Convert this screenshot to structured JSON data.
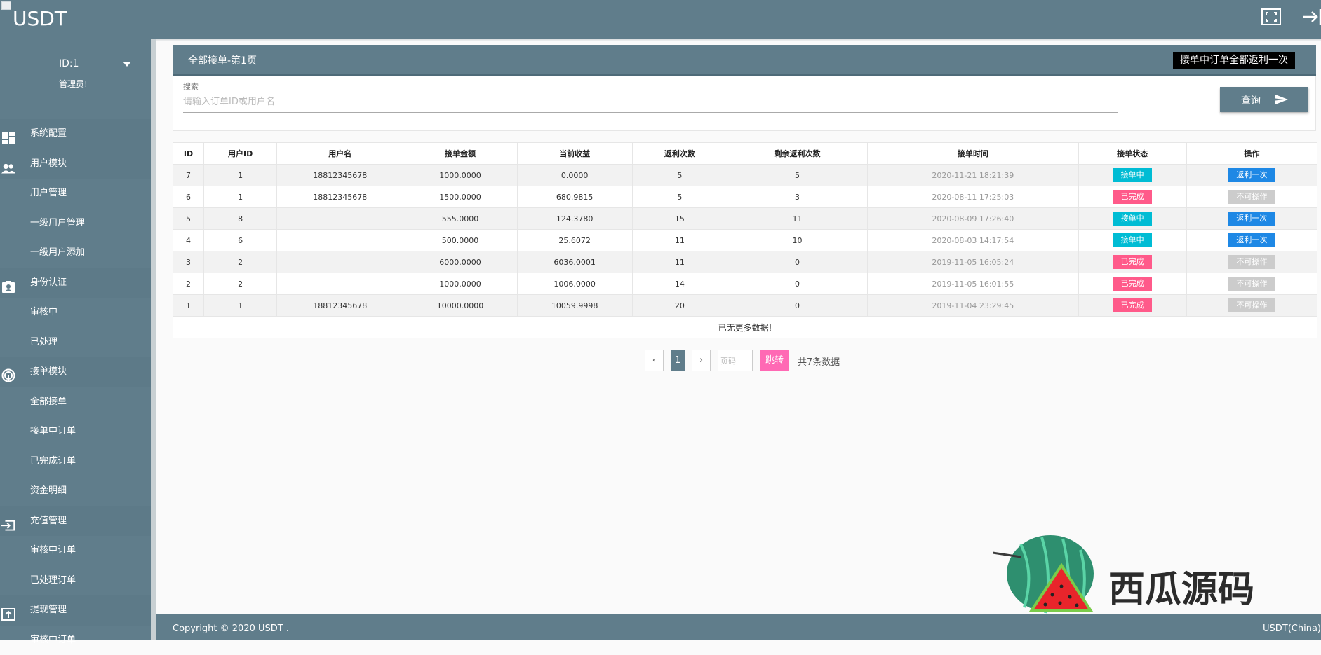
{
  "app": {
    "logo": "USDT"
  },
  "user": {
    "id_label": "ID:1",
    "role": "管理员!"
  },
  "sidebar": {
    "items": [
      {
        "label": "系统配置",
        "icon": "dashboard-icon",
        "top": true
      },
      {
        "label": "用户模块",
        "icon": "users-icon",
        "top": true
      },
      {
        "label": "用户管理"
      },
      {
        "label": "一级用户管理"
      },
      {
        "label": "一级用户添加"
      },
      {
        "label": "身份认证",
        "icon": "id-card-icon",
        "top": true
      },
      {
        "label": "审核中"
      },
      {
        "label": "已处理"
      },
      {
        "label": "接单模块",
        "icon": "fingerprint-icon",
        "top": true
      },
      {
        "label": "全部接单"
      },
      {
        "label": "接单中订单"
      },
      {
        "label": "已完成订单"
      },
      {
        "label": "资金明细"
      },
      {
        "label": "充值管理",
        "icon": "input-icon",
        "top": true
      },
      {
        "label": "审核中订单"
      },
      {
        "label": "已处理订单"
      },
      {
        "label": "提现管理",
        "icon": "upload-icon",
        "top": true
      },
      {
        "label": "审核中订单"
      }
    ]
  },
  "panel": {
    "title": "全部接单-第1页",
    "rebate_all_label": "接单中订单全部返利一次"
  },
  "search": {
    "label": "搜索",
    "placeholder": "请输入订单ID或用户名",
    "value": "",
    "button_label": "查询"
  },
  "table": {
    "headers": [
      "ID",
      "用户ID",
      "用户名",
      "接单金额",
      "当前收益",
      "返利次数",
      "剩余返利次数",
      "接单时间",
      "接单状态",
      "操作"
    ],
    "rows": [
      {
        "id": "7",
        "uid": "1",
        "username": "18812345678",
        "amount": "1000.0000",
        "income": "0.0000",
        "rebates": "5",
        "remaining": "5",
        "time": "2020-11-21 18:21:39",
        "status": "接单中",
        "status_color": "#00bcd4",
        "action": "返利一次",
        "action_color": "#1e88e5"
      },
      {
        "id": "6",
        "uid": "1",
        "username": "18812345678",
        "amount": "1500.0000",
        "income": "680.9815",
        "rebates": "5",
        "remaining": "3",
        "time": "2020-08-11 17:25:03",
        "status": "已完成",
        "status_color": "#ff5a8a",
        "action": "不可操作",
        "action_color": "#cccccc"
      },
      {
        "id": "5",
        "uid": "8",
        "username": "",
        "amount": "555.0000",
        "income": "124.3780",
        "rebates": "15",
        "remaining": "11",
        "time": "2020-08-09 17:26:40",
        "status": "接单中",
        "status_color": "#00bcd4",
        "action": "返利一次",
        "action_color": "#1e88e5"
      },
      {
        "id": "4",
        "uid": "6",
        "username": "",
        "amount": "500.0000",
        "income": "25.6072",
        "rebates": "11",
        "remaining": "10",
        "time": "2020-08-03 14:17:54",
        "status": "接单中",
        "status_color": "#00bcd4",
        "action": "返利一次",
        "action_color": "#1e88e5"
      },
      {
        "id": "3",
        "uid": "2",
        "username": "",
        "amount": "6000.0000",
        "income": "6036.0001",
        "rebates": "11",
        "remaining": "0",
        "time": "2019-11-05 16:05:24",
        "status": "已完成",
        "status_color": "#ff5a8a",
        "action": "不可操作",
        "action_color": "#cccccc"
      },
      {
        "id": "2",
        "uid": "2",
        "username": "",
        "amount": "1000.0000",
        "income": "1006.0000",
        "rebates": "14",
        "remaining": "0",
        "time": "2019-11-05 16:01:55",
        "status": "已完成",
        "status_color": "#ff5a8a",
        "action": "不可操作",
        "action_color": "#cccccc"
      },
      {
        "id": "1",
        "uid": "1",
        "username": "18812345678",
        "amount": "10000.0000",
        "income": "10059.9998",
        "rebates": "20",
        "remaining": "0",
        "time": "2019-11-04 23:29:45",
        "status": "已完成",
        "status_color": "#ff5a8a",
        "action": "不可操作",
        "action_color": "#cccccc"
      }
    ],
    "no_more": "已无更多数据!"
  },
  "pagination": {
    "prev": "‹",
    "current": "1",
    "next": "›",
    "page_placeholder": "页码",
    "go_label": "跳转",
    "total": "共7条数据"
  },
  "footer": {
    "copyright": "Copyright © 2020 USDT .",
    "right": "USDT(China)"
  },
  "watermark": {
    "text": "西瓜源码"
  },
  "colors": {
    "primary": "#607d8b",
    "pink": "#ff69b4"
  }
}
